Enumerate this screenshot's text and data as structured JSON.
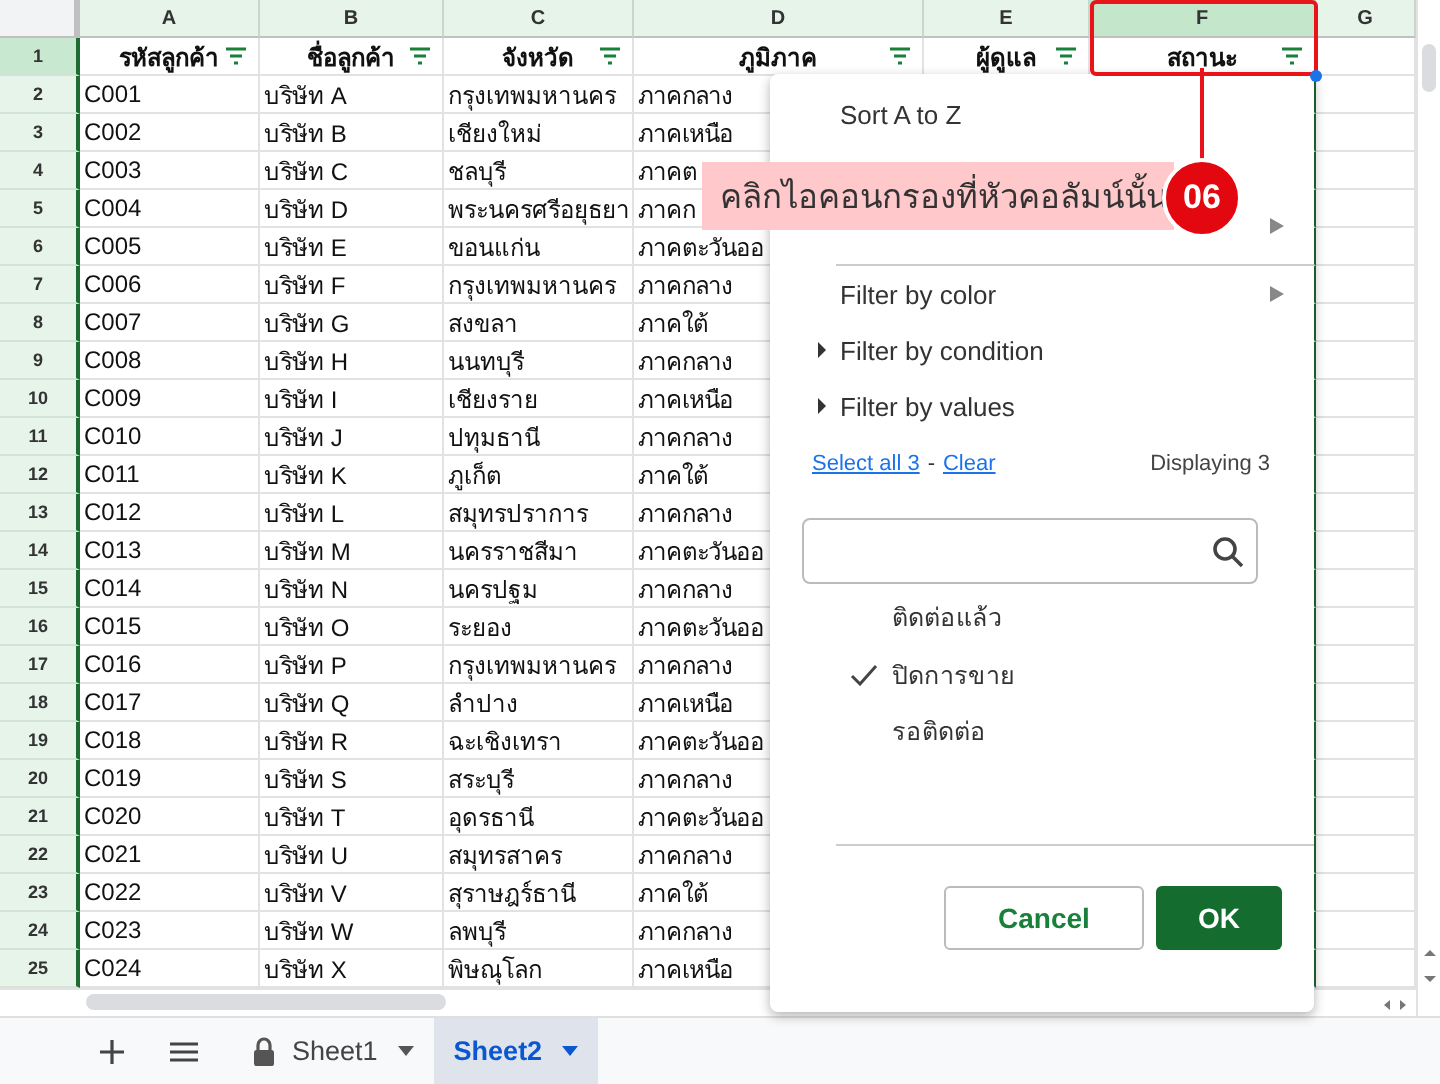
{
  "columns": [
    {
      "letter": "A",
      "selected": false
    },
    {
      "letter": "B",
      "selected": false
    },
    {
      "letter": "C",
      "selected": false
    },
    {
      "letter": "D",
      "selected": false
    },
    {
      "letter": "E",
      "selected": false
    },
    {
      "letter": "F",
      "selected": true
    },
    {
      "letter": "G",
      "selected": false
    }
  ],
  "header_row": {
    "number": "1",
    "cells": [
      {
        "text": "รหัสลูกค้า",
        "filter": true
      },
      {
        "text": "ชื่อลูกค้า",
        "filter": true
      },
      {
        "text": "จังหวัด",
        "filter": true
      },
      {
        "text": "ภูมิภาค",
        "filter": true
      },
      {
        "text": "ผู้ดูแล",
        "filter": true
      },
      {
        "text": "สถานะ",
        "filter": true
      }
    ]
  },
  "rows": [
    {
      "number": "2",
      "cells": [
        "C001",
        "บริษัท A",
        "กรุงเทพมหานคร",
        "ภาคกลาง"
      ]
    },
    {
      "number": "3",
      "cells": [
        "C002",
        "บริษัท B",
        "เชียงใหม่",
        "ภาคเหนือ"
      ]
    },
    {
      "number": "4",
      "cells": [
        "C003",
        "บริษัท C",
        "ชลบุรี",
        "ภาคต"
      ]
    },
    {
      "number": "5",
      "cells": [
        "C004",
        "บริษัท D",
        "พระนครศรีอยุธยา",
        "ภาคก"
      ]
    },
    {
      "number": "6",
      "cells": [
        "C005",
        "บริษัท E",
        "ขอนแก่น",
        "ภาคตะวันออ"
      ]
    },
    {
      "number": "7",
      "cells": [
        "C006",
        "บริษัท F",
        "กรุงเทพมหานคร",
        "ภาคกลาง"
      ]
    },
    {
      "number": "8",
      "cells": [
        "C007",
        "บริษัท G",
        "สงขลา",
        "ภาคใต้"
      ]
    },
    {
      "number": "9",
      "cells": [
        "C008",
        "บริษัท H",
        "นนทบุรี",
        "ภาคกลาง"
      ]
    },
    {
      "number": "10",
      "cells": [
        "C009",
        "บริษัท I",
        "เชียงราย",
        "ภาคเหนือ"
      ]
    },
    {
      "number": "11",
      "cells": [
        "C010",
        "บริษัท J",
        "ปทุมธานี",
        "ภาคกลาง"
      ]
    },
    {
      "number": "12",
      "cells": [
        "C011",
        "บริษัท K",
        "ภูเก็ต",
        "ภาคใต้"
      ]
    },
    {
      "number": "13",
      "cells": [
        "C012",
        "บริษัท L",
        "สมุทรปราการ",
        "ภาคกลาง"
      ]
    },
    {
      "number": "14",
      "cells": [
        "C013",
        "บริษัท M",
        "นครราชสีมา",
        "ภาคตะวันออ"
      ]
    },
    {
      "number": "15",
      "cells": [
        "C014",
        "บริษัท N",
        "นครปฐม",
        "ภาคกลาง"
      ]
    },
    {
      "number": "16",
      "cells": [
        "C015",
        "บริษัท O",
        "ระยอง",
        "ภาคตะวันออ"
      ]
    },
    {
      "number": "17",
      "cells": [
        "C016",
        "บริษัท P",
        "กรุงเทพมหานคร",
        "ภาคกลาง"
      ]
    },
    {
      "number": "18",
      "cells": [
        "C017",
        "บริษัท Q",
        "ลำปาง",
        "ภาคเหนือ"
      ]
    },
    {
      "number": "19",
      "cells": [
        "C018",
        "บริษัท R",
        "ฉะเชิงเทรา",
        "ภาคตะวันออ"
      ]
    },
    {
      "number": "20",
      "cells": [
        "C019",
        "บริษัท S",
        "สระบุรี",
        "ภาคกลาง"
      ]
    },
    {
      "number": "21",
      "cells": [
        "C020",
        "บริษัท T",
        "อุดรธานี",
        "ภาคตะวันออ"
      ]
    },
    {
      "number": "22",
      "cells": [
        "C021",
        "บริษัท U",
        "สมุทรสาคร",
        "ภาคกลาง"
      ]
    },
    {
      "number": "23",
      "cells": [
        "C022",
        "บริษัท V",
        "สุราษฎร์ธานี",
        "ภาคใต้"
      ]
    },
    {
      "number": "24",
      "cells": [
        "C023",
        "บริษัท W",
        "ลพบุรี",
        "ภาคกลาง"
      ]
    },
    {
      "number": "25",
      "cells": [
        "C024",
        "บริษัท X",
        "พิษณุโลก",
        "ภาคเหนือ"
      ]
    }
  ],
  "filter_menu": {
    "sort_items": [
      {
        "label": "Sort A to Z"
      }
    ],
    "filter_items": [
      {
        "label": "Filter by color",
        "kind": "submenu"
      },
      {
        "label": "Filter by condition",
        "kind": "expander",
        "expanded": false
      },
      {
        "label": "Filter by values",
        "kind": "expander",
        "expanded": false
      }
    ],
    "select_all": "Select all 3",
    "link_separator": "-",
    "clear": "Clear",
    "displaying": "Displaying 3",
    "values": [
      {
        "label": "ติดต่อแล้ว",
        "checked": false
      },
      {
        "label": "ปิดการขาย",
        "checked": true
      },
      {
        "label": "รอติดต่อ",
        "checked": false
      }
    ],
    "buttons": [
      {
        "label": "Cancel",
        "kind": "secondary"
      },
      {
        "label": "OK",
        "kind": "primary"
      }
    ]
  },
  "callout": {
    "text": "คลิกไอคอนกรองที่หัวคอลัมน์นั้น",
    "step": "06"
  },
  "sheet_tabs": [
    {
      "label": "Sheet1",
      "selected": false,
      "locked": true
    },
    {
      "label": "Sheet2",
      "selected": true,
      "locked": false
    }
  ]
}
